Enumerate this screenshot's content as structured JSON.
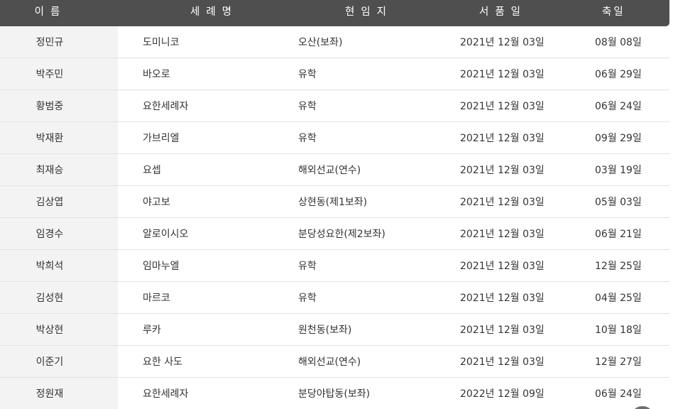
{
  "table": {
    "headers": {
      "name": "이름",
      "baptismal_name": "세례명",
      "current_post": "현임지",
      "ordination_date": "서품일",
      "feast_day": "축일"
    },
    "rows": [
      {
        "name": "정민규",
        "baptismal_name": "도미니코",
        "current_post": "오산(보좌)",
        "ordination_date": "2021년 12월 03일",
        "feast_day": "08월 08일"
      },
      {
        "name": "박주민",
        "baptismal_name": "바오로",
        "current_post": "유학",
        "ordination_date": "2021년 12월 03일",
        "feast_day": "06월 29일"
      },
      {
        "name": "황범중",
        "baptismal_name": "요한세례자",
        "current_post": "유학",
        "ordination_date": "2021년 12월 03일",
        "feast_day": "06월 24일"
      },
      {
        "name": "박재환",
        "baptismal_name": "가브리엘",
        "current_post": "유학",
        "ordination_date": "2021년 12월 03일",
        "feast_day": "09월 29일"
      },
      {
        "name": "최재승",
        "baptismal_name": "요셉",
        "current_post": "해외선교(연수)",
        "ordination_date": "2021년 12월 03일",
        "feast_day": "03월 19일"
      },
      {
        "name": "김상엽",
        "baptismal_name": "야고보",
        "current_post": "상현동(제1보좌)",
        "ordination_date": "2021년 12월 03일",
        "feast_day": "05월 03일"
      },
      {
        "name": "임경수",
        "baptismal_name": "알로이시오",
        "current_post": "분당성요한(제2보좌)",
        "ordination_date": "2021년 12월 03일",
        "feast_day": "06월 21일"
      },
      {
        "name": "박희석",
        "baptismal_name": "임마누엘",
        "current_post": "유학",
        "ordination_date": "2021년 12월 03일",
        "feast_day": "12월 25일"
      },
      {
        "name": "김성현",
        "baptismal_name": "마르코",
        "current_post": "유학",
        "ordination_date": "2021년 12월 03일",
        "feast_day": "04월 25일"
      },
      {
        "name": "박상현",
        "baptismal_name": "루카",
        "current_post": "원천동(보좌)",
        "ordination_date": "2021년 12월 03일",
        "feast_day": "10월 18일"
      },
      {
        "name": "이준기",
        "baptismal_name": "요한 사도",
        "current_post": "해외선교(연수)",
        "ordination_date": "2021년 12월 03일",
        "feast_day": "12월 27일"
      },
      {
        "name": "정원재",
        "baptismal_name": "요한세례자",
        "current_post": "분당야탑동(보좌)",
        "ordination_date": "2022년 12월 09일",
        "feast_day": "06월 24일"
      }
    ]
  },
  "colors": {
    "header_bg": "#4f4f4f",
    "header_text": "#ffffff",
    "name_col_bg": "#f3f3f3",
    "row_border": "#e2e2e2",
    "body_text": "#333333"
  }
}
